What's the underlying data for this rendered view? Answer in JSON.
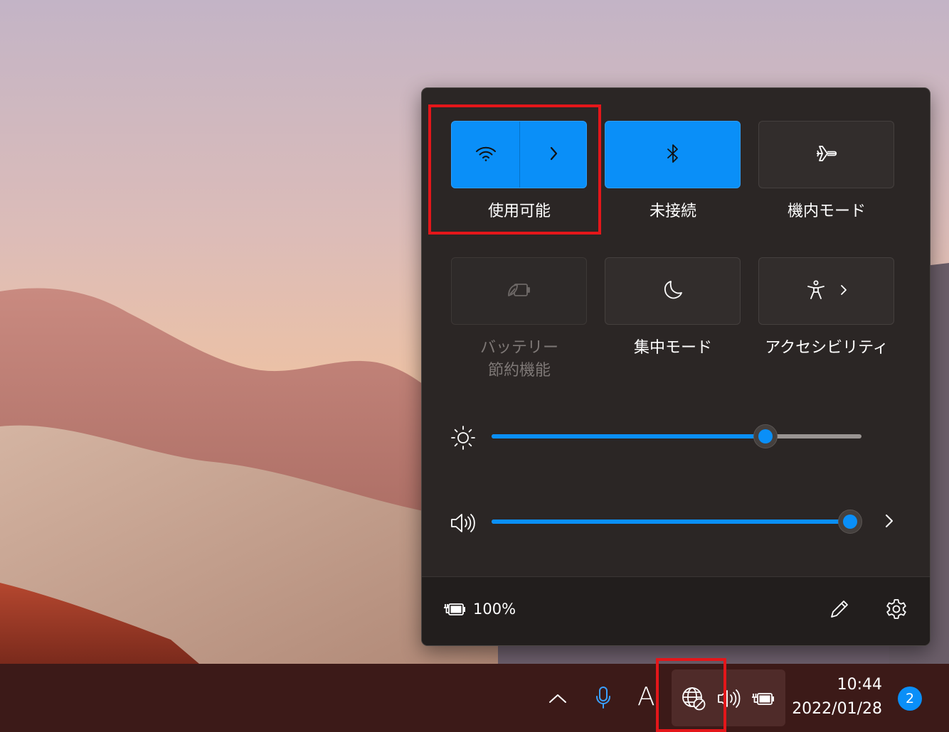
{
  "quick_settings": {
    "tiles": [
      {
        "label": "使用可能",
        "state": "on",
        "icon": "wifi-icon",
        "has_expand": true
      },
      {
        "label": "未接続",
        "state": "on",
        "icon": "bluetooth-icon"
      },
      {
        "label": "機内モード",
        "state": "off",
        "icon": "airplane-icon"
      },
      {
        "label_line1": "バッテリー",
        "label_line2": "節約機能",
        "state": "disabled",
        "icon": "battery-saver-icon"
      },
      {
        "label": "集中モード",
        "state": "off",
        "icon": "moon-icon"
      },
      {
        "label": "アクセシビリティ",
        "state": "off",
        "icon": "accessibility-icon",
        "has_expand": true
      }
    ],
    "brightness": {
      "icon": "brightness-icon",
      "level": 0.74
    },
    "volume": {
      "icon": "volume-icon",
      "level": 0.97
    },
    "footer": {
      "battery_icon": "battery-charging-icon",
      "battery_percent": "100%",
      "edit_icon": "pencil-icon",
      "settings_icon": "gear-icon"
    }
  },
  "taskbar": {
    "tray_icons": [
      "chevron-up-icon",
      "microphone-icon",
      "ime-icon",
      "globe-no-internet-icon",
      "speaker-icon",
      "battery-charging-icon"
    ],
    "ime_label": "A",
    "time": "10:44",
    "date": "2022/01/28",
    "notification_count": "2"
  },
  "colors": {
    "accent": "#0a8ff8",
    "panel_bg": "#2b2625",
    "taskbar_bg": "#3c1a18",
    "highlight_box": "#e4161a"
  }
}
